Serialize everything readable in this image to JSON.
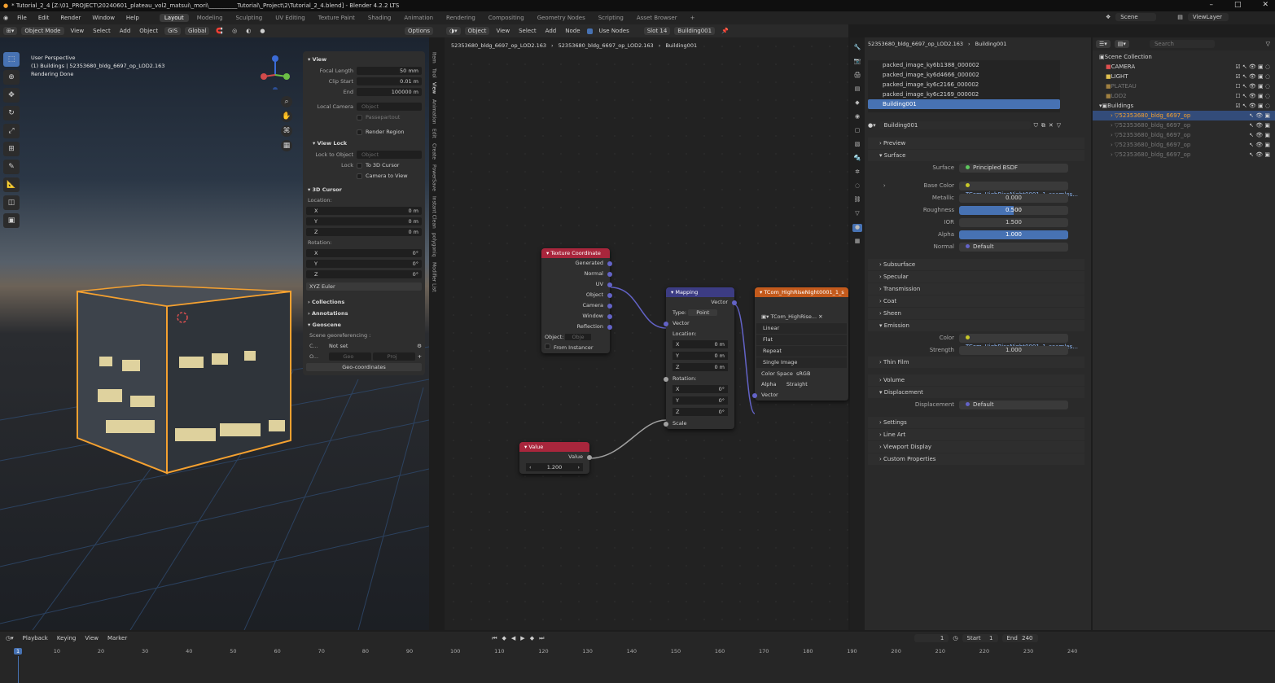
{
  "window": {
    "title": "* Tutorial_2_4 [Z:\\01_PROJECT\\20240601_plateau_vol2_matsui\\_mori\\__________Tutorial\\_Project\\2\\Tutorial_2_4.blend] - Blender 4.2.2 LTS"
  },
  "menu": {
    "items": [
      "File",
      "Edit",
      "Render",
      "Window",
      "Help"
    ],
    "workspaces": [
      "Layout",
      "Modeling",
      "Sculpting",
      "UV Editing",
      "Texture Paint",
      "Shading",
      "Animation",
      "Rendering",
      "Compositing",
      "Geometry Nodes",
      "Scripting",
      "Asset Browser"
    ],
    "scene": "Scene",
    "viewlayer": "ViewLayer"
  },
  "viewport_header": {
    "mode": "Object Mode",
    "items": [
      "View",
      "Select",
      "Add",
      "Object"
    ],
    "gis": "GIS",
    "orientation": "Global",
    "options": "Options"
  },
  "viewport": {
    "info1": "User Perspective",
    "info2": "(1) Buildings | 52353680_bldg_6697_op_LOD2.163",
    "info3": "Rendering Done"
  },
  "npanel": {
    "view_title": "View",
    "focal_label": "Focal Length",
    "focal": "50 mm",
    "clipstart_label": "Clip Start",
    "clipstart": "0.01 m",
    "end_label": "End",
    "end": "100000 m",
    "localcam_label": "Local Camera",
    "localcam_ph": "Object",
    "passepartout": "Passepartout",
    "render_region": "Render Region",
    "viewlock_title": "View Lock",
    "lockobj_label": "Lock to Object",
    "lockobj_ph": "Object",
    "lock_label": "Lock",
    "to3d": "To 3D Cursor",
    "camtoview": "Camera to View",
    "cursor_title": "3D Cursor",
    "location_label": "Location:",
    "x_label": "X",
    "y_label": "Y",
    "z_label": "Z",
    "lx": "0 m",
    "ly": "0 m",
    "lz": "0 m",
    "rotation_label": "Rotation:",
    "rx": "0°",
    "ry": "0°",
    "rz": "0°",
    "euler": "XYZ Euler",
    "collections": "Collections",
    "annotations": "Annotations",
    "geoscene": "Geoscene",
    "georef_label": "Scene georeferencing :",
    "crs_label": "C...",
    "crs_val": "Not set",
    "o_label": "O...",
    "geo_btn": "Geo",
    "proj_btn": "Proj",
    "geocoord": "Geo-coordinates"
  },
  "sidetabs": [
    "Item",
    "Tool",
    "View",
    "Animation",
    "Edit",
    "Create",
    "PowerSave",
    "Instant Clean",
    "polygoniq",
    "Modifier List"
  ],
  "node_header": {
    "object_sel": "Object",
    "items": [
      "View",
      "Select",
      "Add",
      "Node"
    ],
    "use_nodes": "Use Nodes",
    "slot": "Slot 14",
    "material": "Building001"
  },
  "node_breadcrumb": {
    "a": "52353680_bldg_6697_op_LOD2.163",
    "b": "52353680_bldg_6697_op_LOD2.163",
    "c": "Building001"
  },
  "nodes": {
    "texcoord": {
      "title": "Texture Coordinate",
      "outputs": [
        "Generated",
        "Normal",
        "UV",
        "Object",
        "Camera",
        "Window",
        "Reflection"
      ],
      "object_label": "Object:",
      "object_ph": "Obje",
      "from_instancer": "From Instancer"
    },
    "mapping": {
      "title": "Mapping",
      "out_vector": "Vector",
      "type_label": "Type:",
      "type_val": "Point",
      "vector": "Vector",
      "location": "Location:",
      "lx": "0 m",
      "ly": "0 m",
      "lz": "0 m",
      "rotation": "Rotation:",
      "rx": "0°",
      "ry": "0°",
      "rz": "0°",
      "scale": "Scale",
      "x": "X",
      "y": "Y",
      "z": "Z"
    },
    "value": {
      "title": "Value",
      "out": "Value",
      "val": "1.200"
    },
    "image": {
      "title": "TCom_HighRiseNight0001_1_s",
      "img": "TCom_HighRise...",
      "interp": "Linear",
      "proj": "Flat",
      "ext": "Repeat",
      "source": "Single Image",
      "cs_label": "Color Space",
      "cs_val": "sRGB",
      "alpha_label": "Alpha",
      "alpha_val": "Straight",
      "vector": "Vector"
    }
  },
  "properties": {
    "breadcrumb_a": "52353680_bldg_6697_op_LOD2.163",
    "breadcrumb_b": "Building001",
    "slots": [
      "packed_image_ky6b1388_000002",
      "packed_image_ky6d4666_000002",
      "packed_image_ky6c2166_000002",
      "packed_image_ky6c2169_000002",
      "Building001"
    ],
    "material_name": "Building001",
    "preview": "Preview",
    "surface_sect": "Surface",
    "surface_label": "Surface",
    "surface_val": "Principled BSDF",
    "basecolor_label": "Base Color",
    "basecolor_val": "TCom_HighRiseNight0001_1_seamles...",
    "metallic_label": "Metallic",
    "metallic_val": "0.000",
    "roughness_label": "Roughness",
    "roughness_val": "0.500",
    "ior_label": "IOR",
    "ior_val": "1.500",
    "alpha_label": "Alpha",
    "alpha_val": "1.000",
    "normal_label": "Normal",
    "normal_val": "Default",
    "subsurface": "Subsurface",
    "specular": "Specular",
    "transmission": "Transmission",
    "coat": "Coat",
    "sheen": "Sheen",
    "emission": "Emission",
    "em_color_label": "Color",
    "em_color_val": "TCom_HighRiseNight0001_1_seamles...",
    "em_strength_label": "Strength",
    "em_strength_val": "1.000",
    "thinfilm": "Thin Film",
    "volume": "Volume",
    "displacement_sect": "Displacement",
    "disp_label": "Displacement",
    "disp_val": "Default",
    "settings": "Settings",
    "lineart": "Line Art",
    "viewport_display": "Viewport Display",
    "custom_props": "Custom Properties"
  },
  "outliner": {
    "search_ph": "Search",
    "root": "Scene Collection",
    "rows": [
      "CAMERA",
      "LIGHT",
      "PLATEAU",
      "LOD2",
      "Buildings",
      "52353680_bldg_6697_op",
      "52353680_bldg_6697_op",
      "52353680_bldg_6697_op",
      "52353680_bldg_6697_op",
      "52353680_bldg_6697_op"
    ]
  },
  "timeline": {
    "items": [
      "Playback",
      "Keying",
      "View",
      "Marker"
    ],
    "current": "1",
    "start_label": "Start",
    "start": "1",
    "end_label": "End",
    "end": "240",
    "frames": [
      "1",
      "10",
      "20",
      "30",
      "40",
      "50",
      "60",
      "70",
      "80",
      "90",
      "100",
      "110",
      "120",
      "130",
      "140",
      "150",
      "160",
      "170",
      "180",
      "190",
      "200",
      "210",
      "220",
      "230",
      "240"
    ]
  },
  "colors": {
    "accent": "#4772b3",
    "node_input_header": "#a8263c",
    "node_vector_header": "#3c3c83",
    "node_texture_header": "#c35a1c",
    "selection_orange": "#f5a130"
  }
}
